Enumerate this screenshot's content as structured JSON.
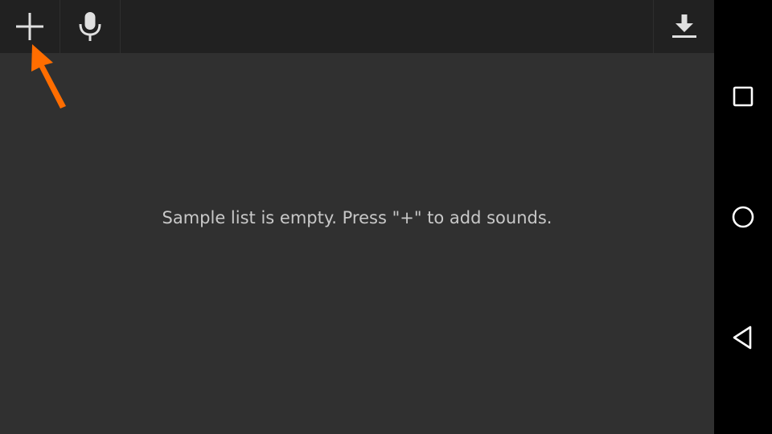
{
  "toolbar": {
    "buttons": [
      {
        "icon": "plus-icon"
      },
      {
        "icon": "microphone-icon"
      },
      {
        "icon": "download-icon"
      }
    ]
  },
  "main": {
    "empty_message": "Sample list is empty. Press \"+\" to add sounds."
  },
  "annotation": {
    "arrow_color": "#FF6D00"
  },
  "navbar": {
    "buttons": [
      {
        "icon": "recents-square-icon"
      },
      {
        "icon": "home-circle-icon"
      },
      {
        "icon": "back-triangle-icon"
      }
    ]
  },
  "colors": {
    "toolbar_bg": "#212121",
    "content_bg": "#303030",
    "navbar_bg": "#000000",
    "icon": "#E0E0E0",
    "text": "#C8C8C8"
  }
}
